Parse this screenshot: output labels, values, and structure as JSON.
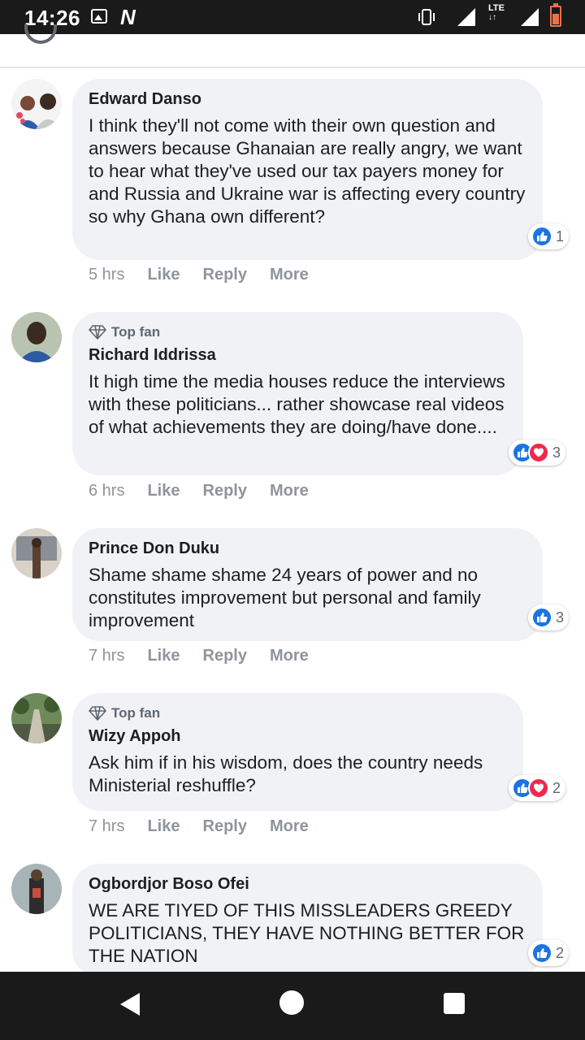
{
  "status_bar": {
    "time": "14:26",
    "network": "LTE"
  },
  "comments": [
    {
      "author": "Edward Danso",
      "top_fan": false,
      "text": "I think they'll not come with their own question and answers because Ghanaian are really angry, we want to hear what they've used our tax payers money for and Russia and Ukraine war is affecting every country so why Ghana own different?",
      "time": "5 hrs",
      "like_label": "Like",
      "reply_label": "Reply",
      "more_label": "More",
      "reactions": [
        "like"
      ],
      "reaction_count": "1"
    },
    {
      "author": "Richard Iddrissa",
      "top_fan": true,
      "badge": "Top fan",
      "text": "It high time the media houses reduce the interviews with these politicians... rather showcase real videos of what achievements they are doing/have done....",
      "time": "6 hrs",
      "like_label": "Like",
      "reply_label": "Reply",
      "more_label": "More",
      "reactions": [
        "like",
        "love"
      ],
      "reaction_count": "3"
    },
    {
      "author": "Prince Don Duku",
      "top_fan": false,
      "text": "Shame shame shame 24 years of power and no constitutes improvement but personal and family improvement",
      "time": "7 hrs",
      "like_label": "Like",
      "reply_label": "Reply",
      "more_label": "More",
      "reactions": [
        "like"
      ],
      "reaction_count": "3"
    },
    {
      "author": "Wizy Appoh",
      "top_fan": true,
      "badge": "Top fan",
      "text": "Ask him if in his wisdom, does the country needs Ministerial reshuffle?",
      "time": "7 hrs",
      "like_label": "Like",
      "reply_label": "Reply",
      "more_label": "More",
      "reactions": [
        "like",
        "love"
      ],
      "reaction_count": "2"
    },
    {
      "author": "Ogbordjor Boso Ofei",
      "top_fan": false,
      "text": "WE ARE TIYED OF THIS MISSLEADERS GREEDY POLITICIANS, THEY HAVE NOTHING BETTER FOR THE NATION",
      "reactions": [
        "like"
      ],
      "reaction_count": "2"
    }
  ],
  "icons": {
    "top_fan": "diamond-icon",
    "like": "thumbs-up-icon",
    "love": "heart-icon",
    "nav_back": "back-triangle-icon",
    "nav_home": "home-circle-icon",
    "nav_recent": "recent-square-icon"
  },
  "colors": {
    "like": "#1b74e4",
    "love": "#f0284a",
    "bubble": "#f0f2f5"
  }
}
